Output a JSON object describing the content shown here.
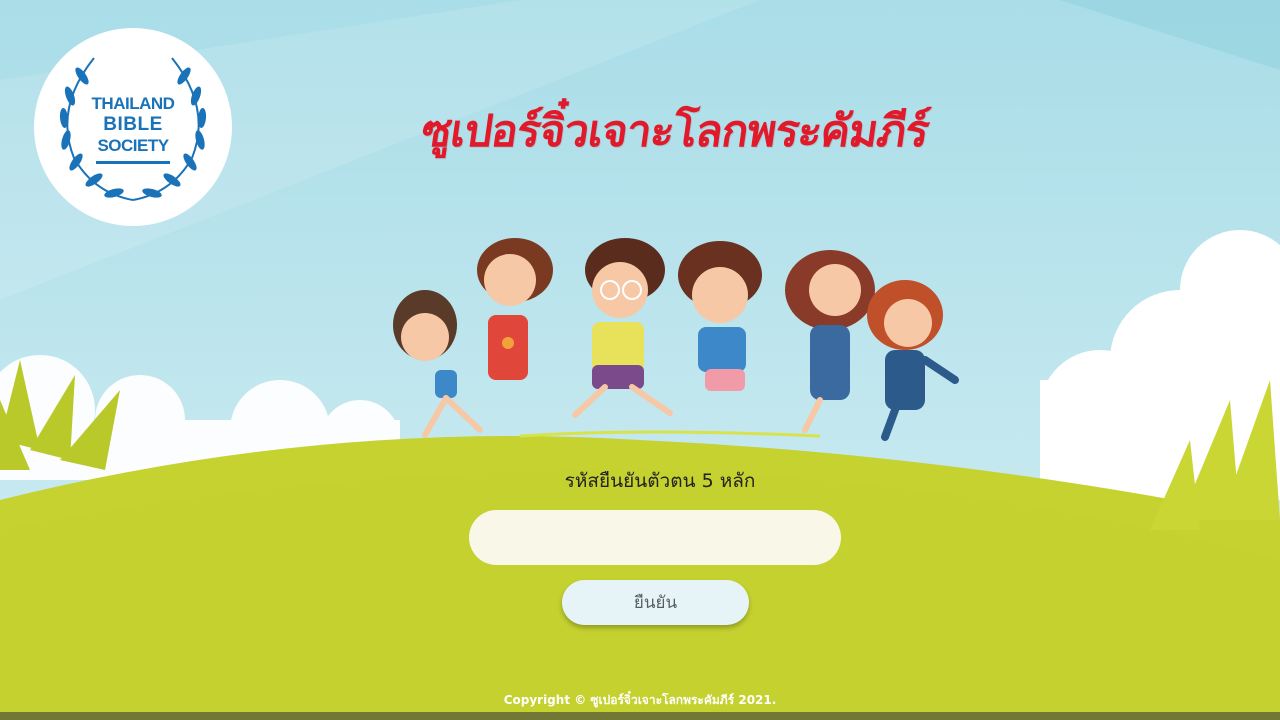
{
  "logo": {
    "line1": "THAILAND",
    "line2": "BIBLE",
    "line3": "SOCIETY"
  },
  "title": "ซูเปอร์จิ๋วเจาะโลกพระคัมภีร์",
  "form": {
    "label": "รหัสยืนยันตัวตน 5 หลัก",
    "code_value": "",
    "confirm_label": "ยืนยัน"
  },
  "footer": {
    "copyright": "Copyright © ซูเปอร์จิ๋วเจาะโลกพระคัมภีร์ 2021."
  },
  "colors": {
    "sky": "#b3e0ea",
    "grass": "#c5d22f",
    "title": "#e0192b",
    "logo_blue": "#1a73b8"
  }
}
